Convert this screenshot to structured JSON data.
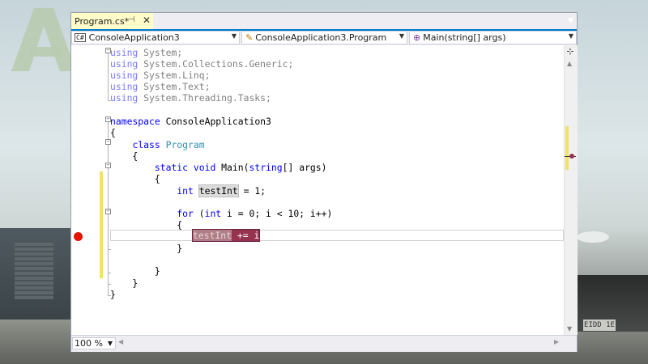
{
  "document_tab": {
    "title": "Program.cs*",
    "pin_icon": "pin-icon",
    "close_glyph": "✕"
  },
  "navigation": {
    "project": "ConsoleApplication3",
    "class": "ConsoleApplication3.Program",
    "member": "Main(string[] args)"
  },
  "code_lines": [
    "using System;",
    "using System.Collections.Generic;",
    "using System.Linq;",
    "using System.Text;",
    "using System.Threading.Tasks;",
    "",
    "namespace ConsoleApplication3",
    "{",
    "    class Program",
    "    {",
    "        static void Main(string[] args)",
    "        {",
    "            int testInt = 1;",
    "",
    "            for (int i = 0; i < 10; i++)",
    "            {",
    "                testInt += i;",
    "            }",
    "",
    "        }",
    "    }",
    "}"
  ],
  "breakpoint_text": {
    "var": "testInt",
    "rest": " += i;"
  },
  "zoom": "100 %",
  "background": {
    "vehicle_plate": "EIDD 1E"
  },
  "colors": {
    "accent": "#007acc",
    "breakpoint": "#e51400",
    "breakpoint_highlight": "#963450",
    "keyword": "#0000ff",
    "type": "#2b91af"
  }
}
